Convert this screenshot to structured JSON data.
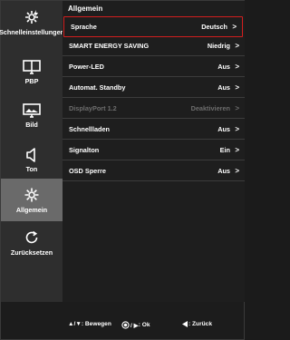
{
  "sidebar": {
    "items": [
      {
        "label": "Schnelleinstellungen",
        "icon": "quick-settings-icon",
        "active": false
      },
      {
        "label": "PBP",
        "icon": "pbp-icon",
        "active": false
      },
      {
        "label": "Bild",
        "icon": "picture-icon",
        "active": false
      },
      {
        "label": "Ton",
        "icon": "speaker-icon",
        "active": false
      },
      {
        "label": "Allgemein",
        "icon": "gear-icon",
        "active": true
      },
      {
        "label": "Zurücksetzen",
        "icon": "reset-icon",
        "active": false
      }
    ]
  },
  "main": {
    "section_title": "Allgemein",
    "rows": [
      {
        "label": "Sprache",
        "value": "Deutsch",
        "arrow": ">",
        "selected": true,
        "disabled": false
      },
      {
        "label": "SMART ENERGY SAVING",
        "value": "Niedrig",
        "arrow": ">",
        "selected": false,
        "disabled": false
      },
      {
        "label": "Power-LED",
        "value": "Aus",
        "arrow": ">",
        "selected": false,
        "disabled": false
      },
      {
        "label": "Automat. Standby",
        "value": "Aus",
        "arrow": ">",
        "selected": false,
        "disabled": false
      },
      {
        "label": "DisplayPort 1.2",
        "value": "Deaktivieren",
        "arrow": ">",
        "selected": false,
        "disabled": true
      },
      {
        "label": "Schnellladen",
        "value": "Aus",
        "arrow": ">",
        "selected": false,
        "disabled": false
      },
      {
        "label": "Signalton",
        "value": "Ein",
        "arrow": ">",
        "selected": false,
        "disabled": false
      },
      {
        "label": "OSD Sperre",
        "value": "Aus",
        "arrow": ">",
        "selected": false,
        "disabled": false
      }
    ]
  },
  "footer": {
    "move_keys": "▲/▼",
    "move_label": ": Bewegen",
    "ok_keys": "/ ▶",
    "ok_label": ": Ok",
    "back_label": ": Zurück"
  },
  "colors": {
    "highlight": "#d21e1e",
    "sidebar_bg": "#2e2e2e",
    "sidebar_active": "#6a6a6a",
    "disabled_text": "#6d6d6d"
  }
}
